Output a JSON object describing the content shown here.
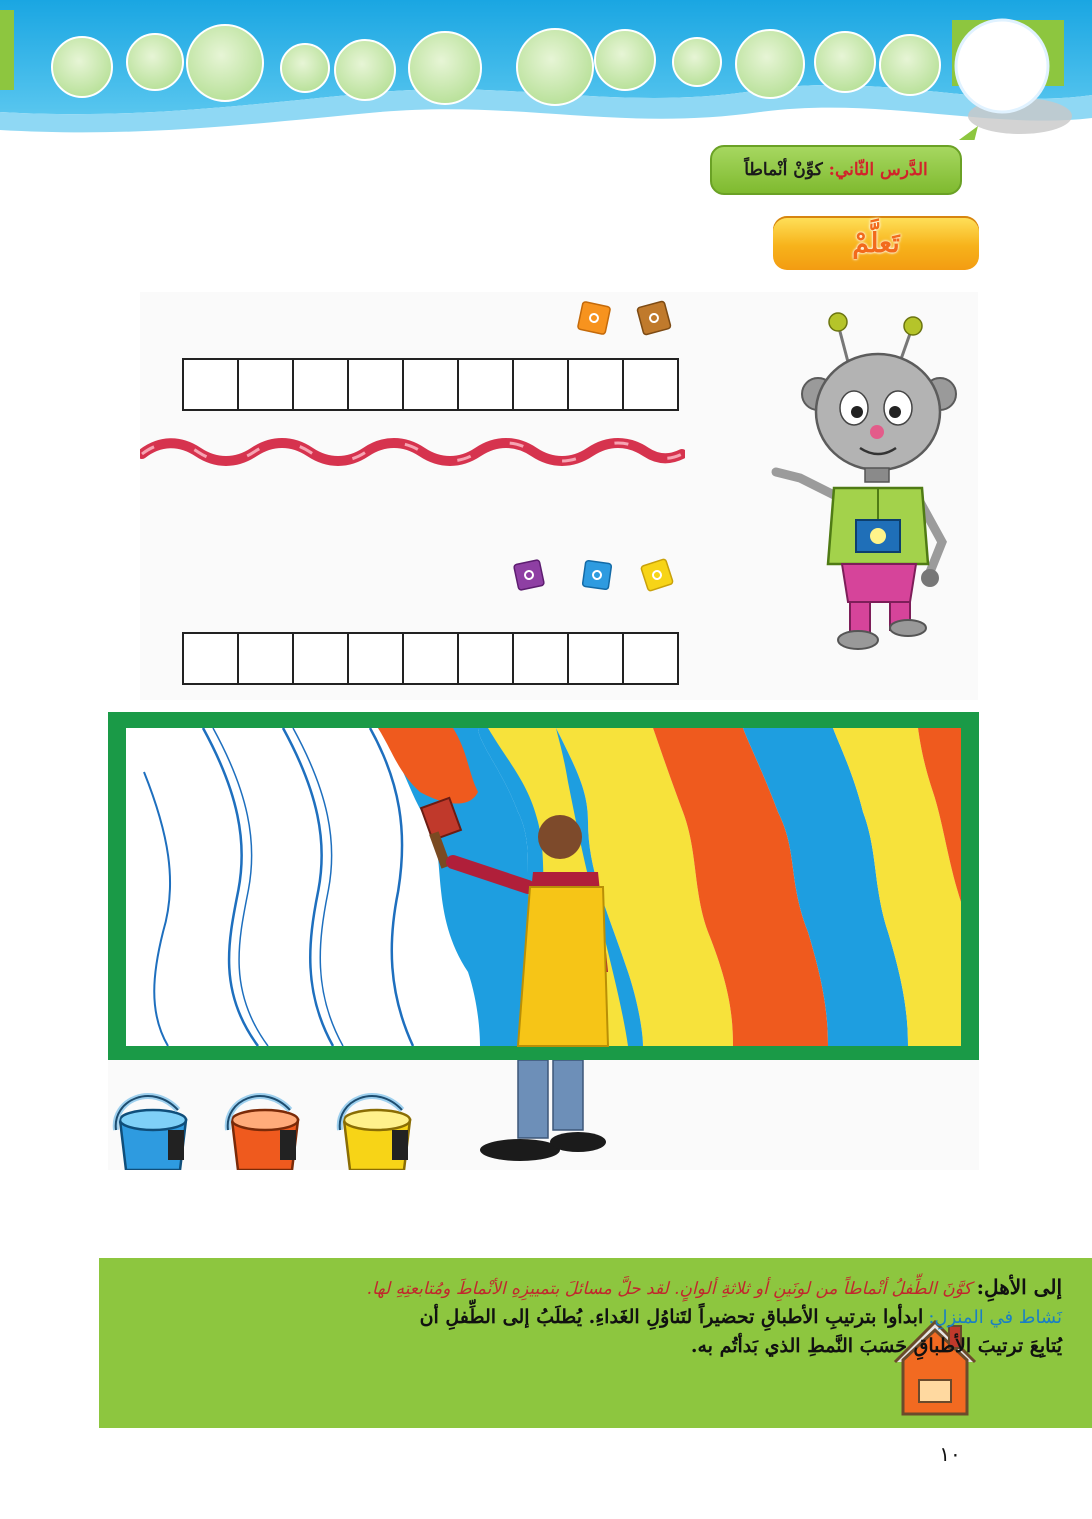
{
  "header": {
    "colors": {
      "top": "#1eaee6",
      "wave": "#4dc3ee",
      "bubble": "#c5e8a8",
      "accent": "#8dc63f"
    }
  },
  "lesson": {
    "label": "الدَّرس الثّاني:",
    "title": "كوِّنْ أنْماطاً"
  },
  "learn_banner": {
    "text": "تَعلَّمْ"
  },
  "activity": {
    "row1_cells": 9,
    "row2_cells": 9,
    "row1_icons": [
      "orange-gem-icon",
      "brown-gem-icon"
    ],
    "row2_icons": [
      "purple-gem-icon",
      "blue-gem-icon",
      "yellow-gem-icon"
    ],
    "character": "robot-girl-mascot"
  },
  "painting": {
    "stripe_colors": [
      "#ffffff",
      "#ffffff",
      "#ffffff",
      "#ffffff",
      "#ef5a1e",
      "#1e9ee0",
      "#f7e23b",
      "#ef5a1e",
      "#1e9ee0",
      "#f7e23b",
      "#ef5a1e"
    ],
    "frame_color": "#1a9a47",
    "paint_buckets": [
      "blue-paint-bucket-icon",
      "orange-paint-bucket-icon",
      "yellow-paint-bucket-icon"
    ]
  },
  "parents": {
    "title": "إلى الأهلِ:",
    "intro": "كوَّنَ الطِّفلُ أنْماطاً من لونَينِ أو ثلاثةِ ألوانٍ. لقد حلَّ مسائلَ بتمييزِهِ الأنْماطَ ومُتابعتِهِ لها.",
    "activity_label": "نَشاط في المنزلِ:",
    "activity_text": "ابدأوا بترتيبِ الأطباقِ تحضيراً لتَناوُلِ الغَداءِ. يُطلَبُ إلى الطِّفلِ أن",
    "activity_text2": "يُتابِعَ ترتيبَ الأطباقِ حَسَبَ النَّمطِ الذي بَدأتُم به."
  },
  "page_number": "١٠"
}
